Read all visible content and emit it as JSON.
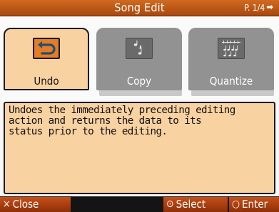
{
  "header": {
    "title": "Song Edit",
    "page": "P. 1/4",
    "page_arrow": "➡"
  },
  "functions": [
    {
      "label": "Undo",
      "icon": "undo-icon",
      "selected": true
    },
    {
      "label": "Copy",
      "icon": "copy-icon",
      "selected": false
    },
    {
      "label": "Quantize",
      "icon": "quantize-icon",
      "selected": false
    }
  ],
  "description": "Undoes the immediately preceding editing\naction and returns the data to its\nstatus prior to the editing.",
  "footer": {
    "close_glyph": "×",
    "close_label": "Close",
    "select_glyph": "⊙",
    "select_label": "Select",
    "enter_glyph": "○",
    "enter_label": "Enter"
  },
  "colors": {
    "accent": "#c65a17",
    "selected_bg": "#f8d2a0",
    "unselected_bg": "#929292"
  }
}
